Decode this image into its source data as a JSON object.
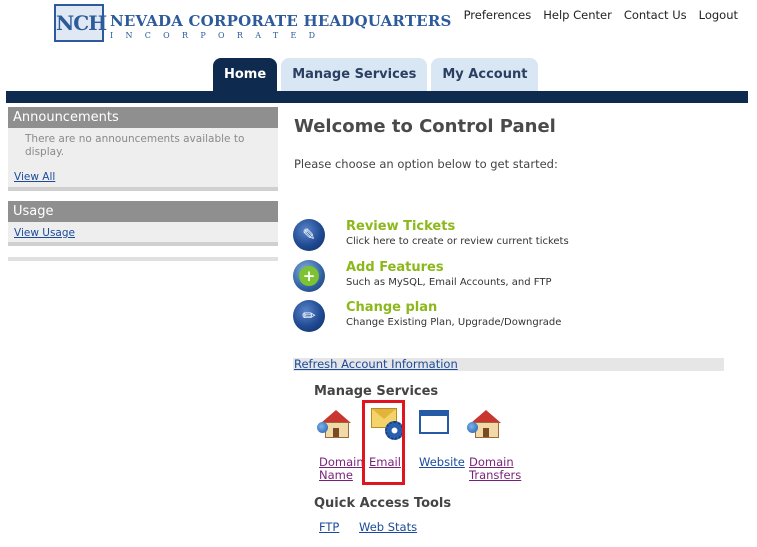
{
  "header": {
    "logo_mark": "NCH",
    "logo_line1": "Nevada Corporate Headquarters",
    "logo_line2": "Incorporated",
    "top_links": [
      "Preferences",
      "Help Center",
      "Contact Us",
      "Logout"
    ]
  },
  "tabs": [
    {
      "label": "Home",
      "active": true
    },
    {
      "label": "Manage Services",
      "active": false
    },
    {
      "label": "My Account",
      "active": false
    }
  ],
  "sidebar": {
    "announcements": {
      "title": "Announcements",
      "text": "There are no announcements available to display.",
      "link": "View All"
    },
    "usage": {
      "title": "Usage",
      "link": "View Usage"
    }
  },
  "main": {
    "title": "Welcome to Control Panel",
    "intro": "Please choose an option below to get started:",
    "options": [
      {
        "title": "Review Tickets",
        "subtitle": "Click here to create or review current tickets",
        "icon": "pen-icon"
      },
      {
        "title": "Add Features",
        "subtitle": "Such as MySQL, Email Accounts, and FTP",
        "icon": "plus-icon"
      },
      {
        "title": "Change plan",
        "subtitle": "Change Existing Plan, Upgrade/Downgrade",
        "icon": "pencil-icon"
      }
    ],
    "refresh_link": "Refresh Account Information",
    "manage_services": {
      "title": "Manage Services",
      "items": [
        {
          "label": "Domain Name",
          "icon": "house-globe-icon"
        },
        {
          "label": "Email",
          "icon": "envelope-gear-icon"
        },
        {
          "label": "Website",
          "icon": "browser-window-icon"
        },
        {
          "label": "Domain Transfers",
          "icon": "house-globe-icon"
        }
      ]
    },
    "quick_access": {
      "title": "Quick Access Tools",
      "items": [
        "FTP",
        "Web Stats"
      ]
    }
  },
  "colors": {
    "nav_dark": "#0e2a4f",
    "tab_light": "#d9e6f3",
    "option_title": "#8cb81b",
    "highlight_box": "#e0161f",
    "panel_head": "#8f8f8f"
  }
}
